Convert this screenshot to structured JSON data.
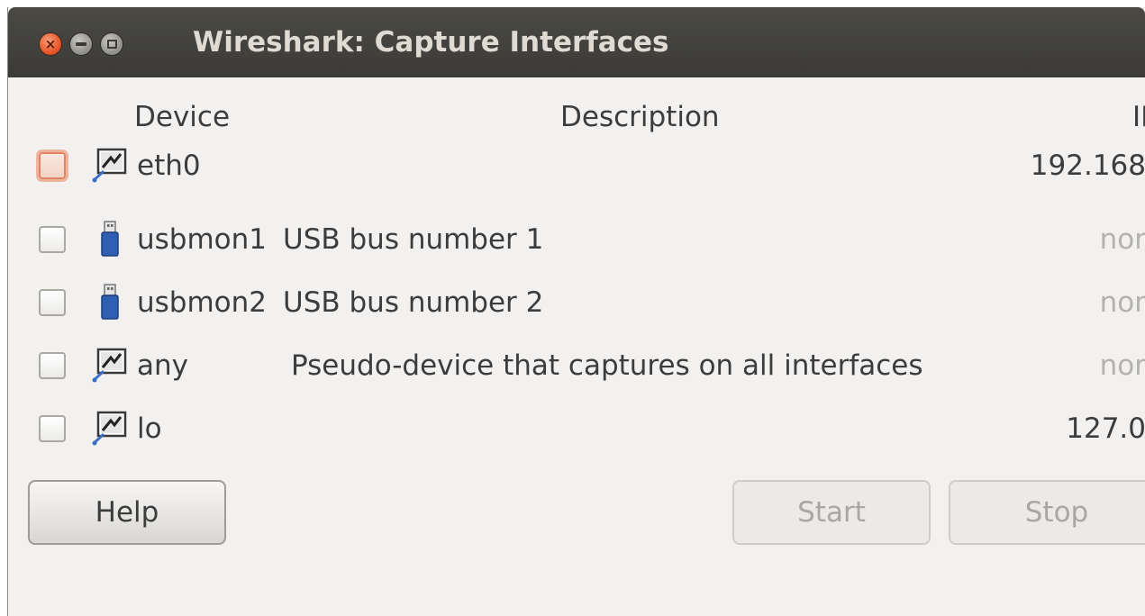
{
  "window": {
    "title": "Wireshark: Capture Interfaces"
  },
  "columns": {
    "device": "Device",
    "description": "Description",
    "ip": "IP"
  },
  "interfaces": [
    {
      "device": "eth0",
      "description": "",
      "ip": "192.168",
      "icon": "network-interface-icon",
      "ip_muted": false,
      "focused": true
    },
    {
      "device": "usbmon1",
      "description": "USB bus number 1",
      "ip": "nor",
      "icon": "usb-drive-icon",
      "ip_muted": true,
      "focused": false
    },
    {
      "device": "usbmon2",
      "description": "USB bus number 2",
      "ip": "nor",
      "icon": "usb-drive-icon",
      "ip_muted": true,
      "focused": false
    },
    {
      "device": "any",
      "description": "Pseudo-device that captures on all interfaces",
      "ip": "nor",
      "icon": "network-interface-icon",
      "ip_muted": true,
      "focused": false
    },
    {
      "device": "lo",
      "description": "",
      "ip": "127.0",
      "icon": "network-interface-icon",
      "ip_muted": false,
      "focused": false
    }
  ],
  "buttons": {
    "help": "Help",
    "start": "Start",
    "stop": "Stop"
  },
  "colors": {
    "titlebar": "#3c3b37",
    "close_button": "#e8572b",
    "focus_ring": "#eeb49c",
    "background": "#f2f1f0"
  }
}
